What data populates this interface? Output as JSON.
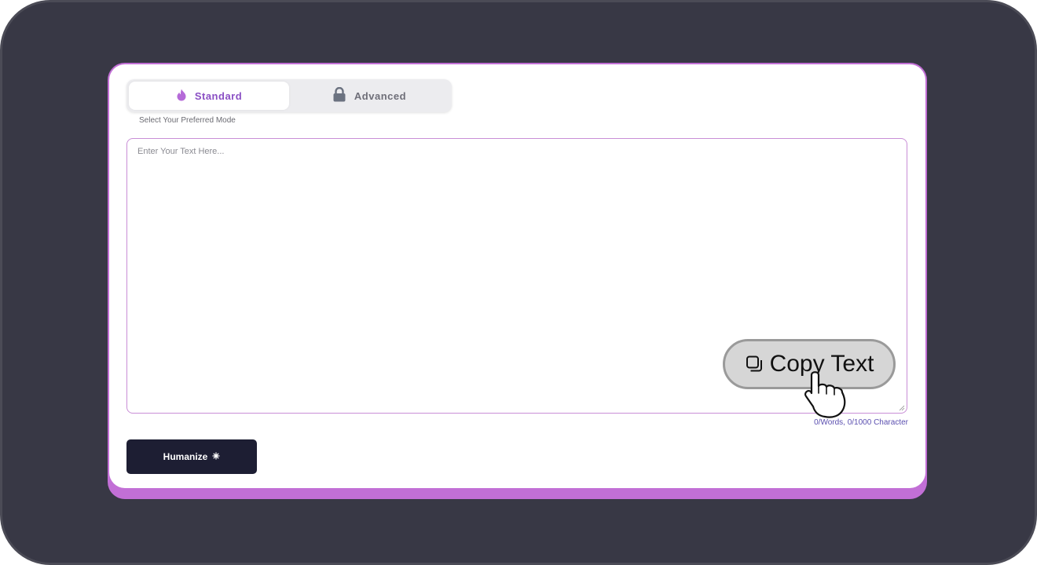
{
  "mode_toggle": {
    "standard_label": "Standard",
    "advanced_label": "Advanced",
    "standard_icon": "flame-icon",
    "advanced_icon": "lock-icon",
    "selected": "Standard",
    "hint": "Select Your Preferred Mode"
  },
  "editor": {
    "placeholder": "Enter Your Text Here...",
    "value": "",
    "counter": "0/Words, 0/1000 Character"
  },
  "humanize_button": {
    "label": "Humanize",
    "icon": "sparkle-icon"
  },
  "overlay": {
    "copy_label": "Copy Text",
    "copy_icon": "copy-icon",
    "cursor_icon": "hand-pointer-icon"
  },
  "colors": {
    "frame": "#383845",
    "card_accent": "#c26fd6",
    "standard_accent": "#8a4fc4",
    "button_dark": "#1d1e33",
    "counter_text": "#5b4fb0",
    "copy_button_bg": "#d6d6d6"
  }
}
